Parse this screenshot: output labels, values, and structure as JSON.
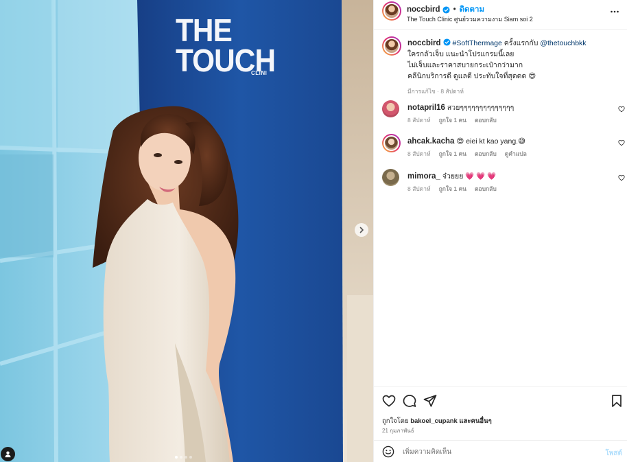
{
  "post": {
    "username": "noccbird",
    "bullet": "•",
    "follow_label": "ติดตาม",
    "location": "The Touch Clinic ศูนย์รวมความงาม Siam soi 2",
    "more_icon": "more-horizontal-icon"
  },
  "media": {
    "brand_line1": "THE",
    "brand_line2": "TOUCH",
    "brand_sub": "CLINI",
    "next_icon": "chevron-right-icon",
    "carousel_count": 4,
    "carousel_active": 1
  },
  "caption": {
    "username": "noccbird",
    "hashtag": "#SoftThermage",
    "text1": " ครั้งแรกกับ ",
    "mention": "@thetouchbkk",
    "line2": "ใครกลัวเจ็บ แนะนำโปรแกรมนี้เลย",
    "line3": "ไม่เจ็บและราคาสบายกระเป๋ากว่ามาก",
    "line4": "คลีนิกบริการดี ดูแลดี ประทับใจที่สุดดด 😍",
    "meta": "มีการแก้ไข · 8 สัปดาห์"
  },
  "comments": [
    {
      "username": "notapril16",
      "text": "สวยๆๆๆๆๆๆๆๆๆๆๆๆๆๆ",
      "time": "8 สัปดาห์",
      "likes": "ถูกใจ 1 คน",
      "reply": "ตอบกลับ",
      "translate": ""
    },
    {
      "username": "ahcak.kacha",
      "text": "😍 eiei kt kao yang.😅",
      "time": "8 สัปดาห์",
      "likes": "ถูกใจ 1 คน",
      "reply": "ตอบกลับ",
      "translate": "ดูคำแปล"
    },
    {
      "username": "mimora_",
      "text": "จ๋วยยย 💗 💗 💗",
      "time": "8 สัปดาห์",
      "likes": "ถูกใจ 1 คน",
      "reply": "ตอบกลับ",
      "translate": ""
    }
  ],
  "actions": {
    "like_icon": "heart-icon",
    "comment_icon": "comment-icon",
    "share_icon": "share-icon",
    "save_icon": "bookmark-icon",
    "liked_by_prefix": "ถูกใจโดย ",
    "liked_by_user": "bakoel_cupank",
    "liked_by_suffix": " และคนอื่นๆ",
    "date": "21 กุมภาพันธ์"
  },
  "add_comment": {
    "placeholder": "เพิ่มความคิดเห็น",
    "post_label": "โพสต์",
    "emoji_icon": "emoji-icon"
  },
  "colors": {
    "accent": "#0095f6",
    "mention": "#00376b",
    "muted": "#8e8e8e",
    "wall_blue": "#1d4f9a",
    "shelf_blue": "#8fd0e6"
  }
}
